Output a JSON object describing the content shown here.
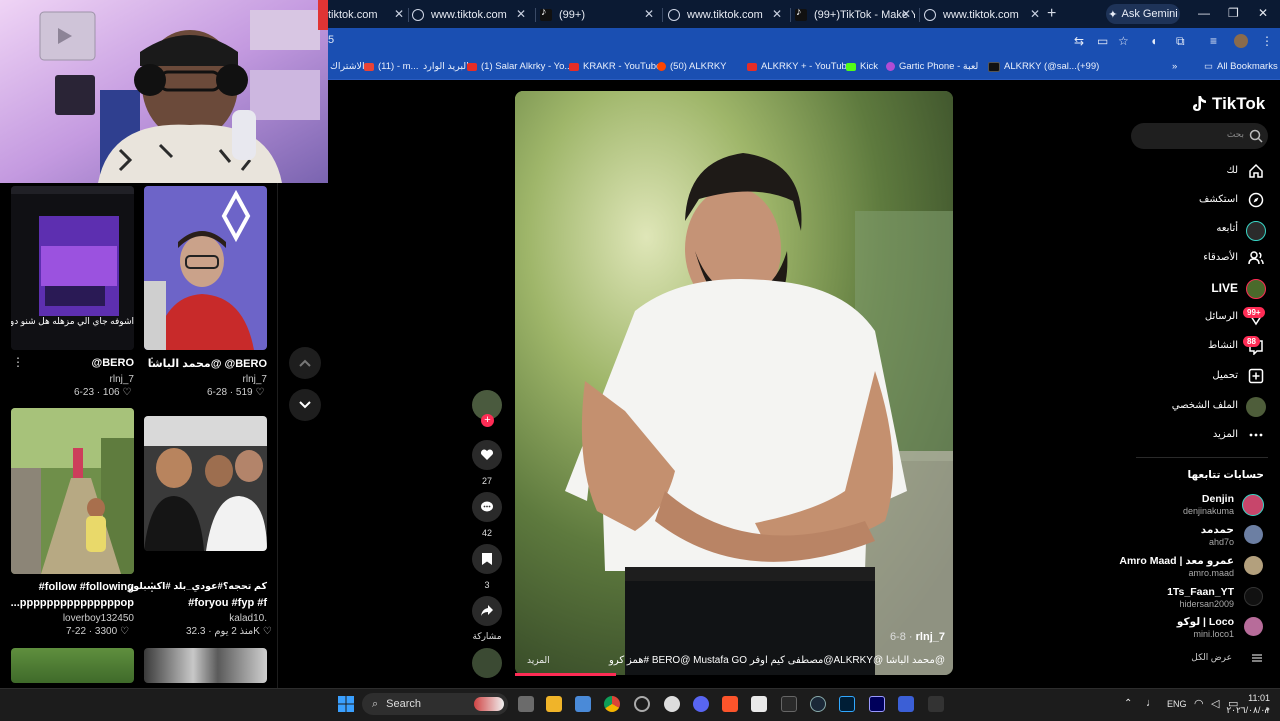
{
  "browser": {
    "tabs": [
      {
        "title": "tiktok.com",
        "active": false
      },
      {
        "title": "www.tiktok.com",
        "active": false
      },
      {
        "title": "(99+)",
        "active": false
      },
      {
        "title": "www.tiktok.com",
        "active": false
      },
      {
        "title": "(99+)TikTok - Make Yo",
        "active": false
      },
      {
        "title": "www.tiktok.com",
        "active": true
      }
    ],
    "new_tab": "+",
    "gemini": "Ask Gemini",
    "address_fragment": "5",
    "bookmarks": [
      {
        "label": "الاشتراك",
        "icon": "none"
      },
      {
        "label": "(11) - m...",
        "icon": "gmail"
      },
      {
        "label": "البريد الوارد",
        "icon": "none"
      },
      {
        "label": "(1) Salar Alkrky - Yo...",
        "icon": "youtube"
      },
      {
        "label": "KRAKR - YouTube",
        "icon": "youtube"
      },
      {
        "label": "(50) ALKRKY",
        "icon": "reddit"
      },
      {
        "label": "ALKRKY + - YouTube",
        "icon": "youtube"
      },
      {
        "label": "Kick",
        "icon": "kick"
      },
      {
        "label": "Gartic Phone - لعبة",
        "icon": "gartic"
      },
      {
        "label": "ALKRKY (@sal...(+99)",
        "icon": "tiktok"
      }
    ],
    "all_bookmarks": "All Bookmarks"
  },
  "feed": {
    "cards": [
      {
        "overlay": "اشوفه جاي الي مزهله هل شنو دو",
        "title": "BERO@",
        "user": "rlnj_7",
        "likes": "106",
        "date": "6-23"
      },
      {
        "overlay": "",
        "title": "BERO@ @محمد الباشا",
        "user": "rlnj_7",
        "likes": "519",
        "date": "6-28"
      },
      {
        "overlay": "",
        "title": "follow #following#",
        "title2": "pppppppppppppppop...",
        "user": "loverboy132450",
        "likes": "3300",
        "date": "7-22"
      },
      {
        "overlay": "",
        "title": "كم تحجه؟#عودي_بلد #اكسبلور",
        "title2": "foryou #fyp #f#",
        "user": "kalad10.",
        "likes": "32.3K",
        "date": "منذ 2 يوم"
      }
    ]
  },
  "video": {
    "author": "rlnj_7",
    "date": "6-8",
    "caption": "@محمد الباشا @ALKRKY@مصطفى كيم اوفر BERO@ Mustafa GO #همز كرو",
    "more": "المزيد",
    "progress": 0.23,
    "actions": {
      "likes": "27",
      "comments": "42",
      "saves": "3",
      "share": "مشاركة"
    }
  },
  "sidebar": {
    "logo": "TikTok",
    "search_placeholder": "بحث",
    "nav": [
      {
        "label": "لك",
        "icon": "home-icon"
      },
      {
        "label": "استكشف",
        "icon": "compass-icon"
      },
      {
        "label": "أتابعه",
        "icon": "following-icon"
      },
      {
        "label": "الأصدقاء",
        "icon": "friends-icon"
      },
      {
        "label": "LIVE",
        "icon": "live-icon"
      },
      {
        "label": "الرسائل",
        "icon": "messages-icon",
        "badge": "99+"
      },
      {
        "label": "النشاط",
        "icon": "activity-icon",
        "badge": "88"
      },
      {
        "label": "تحميل",
        "icon": "upload-icon"
      },
      {
        "label": "الملف الشخصي",
        "icon": "profile-icon"
      },
      {
        "label": "المزيد",
        "icon": "more-icon"
      }
    ],
    "following_title": "حسابات تتابعها",
    "following": [
      {
        "name": "Denjin",
        "handle": "denjinakuma",
        "color": "#c7466b"
      },
      {
        "name": "حمدمد",
        "handle": "ahd7o",
        "color": "#6c7fa3"
      },
      {
        "name": "Amro Maad | عمرو معد",
        "handle": "amro.maad",
        "color": "#b3a07d"
      },
      {
        "name": "1Ts_Faan_YT",
        "handle": "hidersan2009",
        "color": "#111111"
      },
      {
        "name": "لوكو | Loco",
        "handle": "mini.loco1",
        "color": "#b76c9a"
      }
    ],
    "see_all": "عرض الكل"
  },
  "taskbar": {
    "search": "Search",
    "lang": "ENG",
    "time": "11:01 م",
    "date": "٢٠٢٦/٠٨/٠١"
  }
}
